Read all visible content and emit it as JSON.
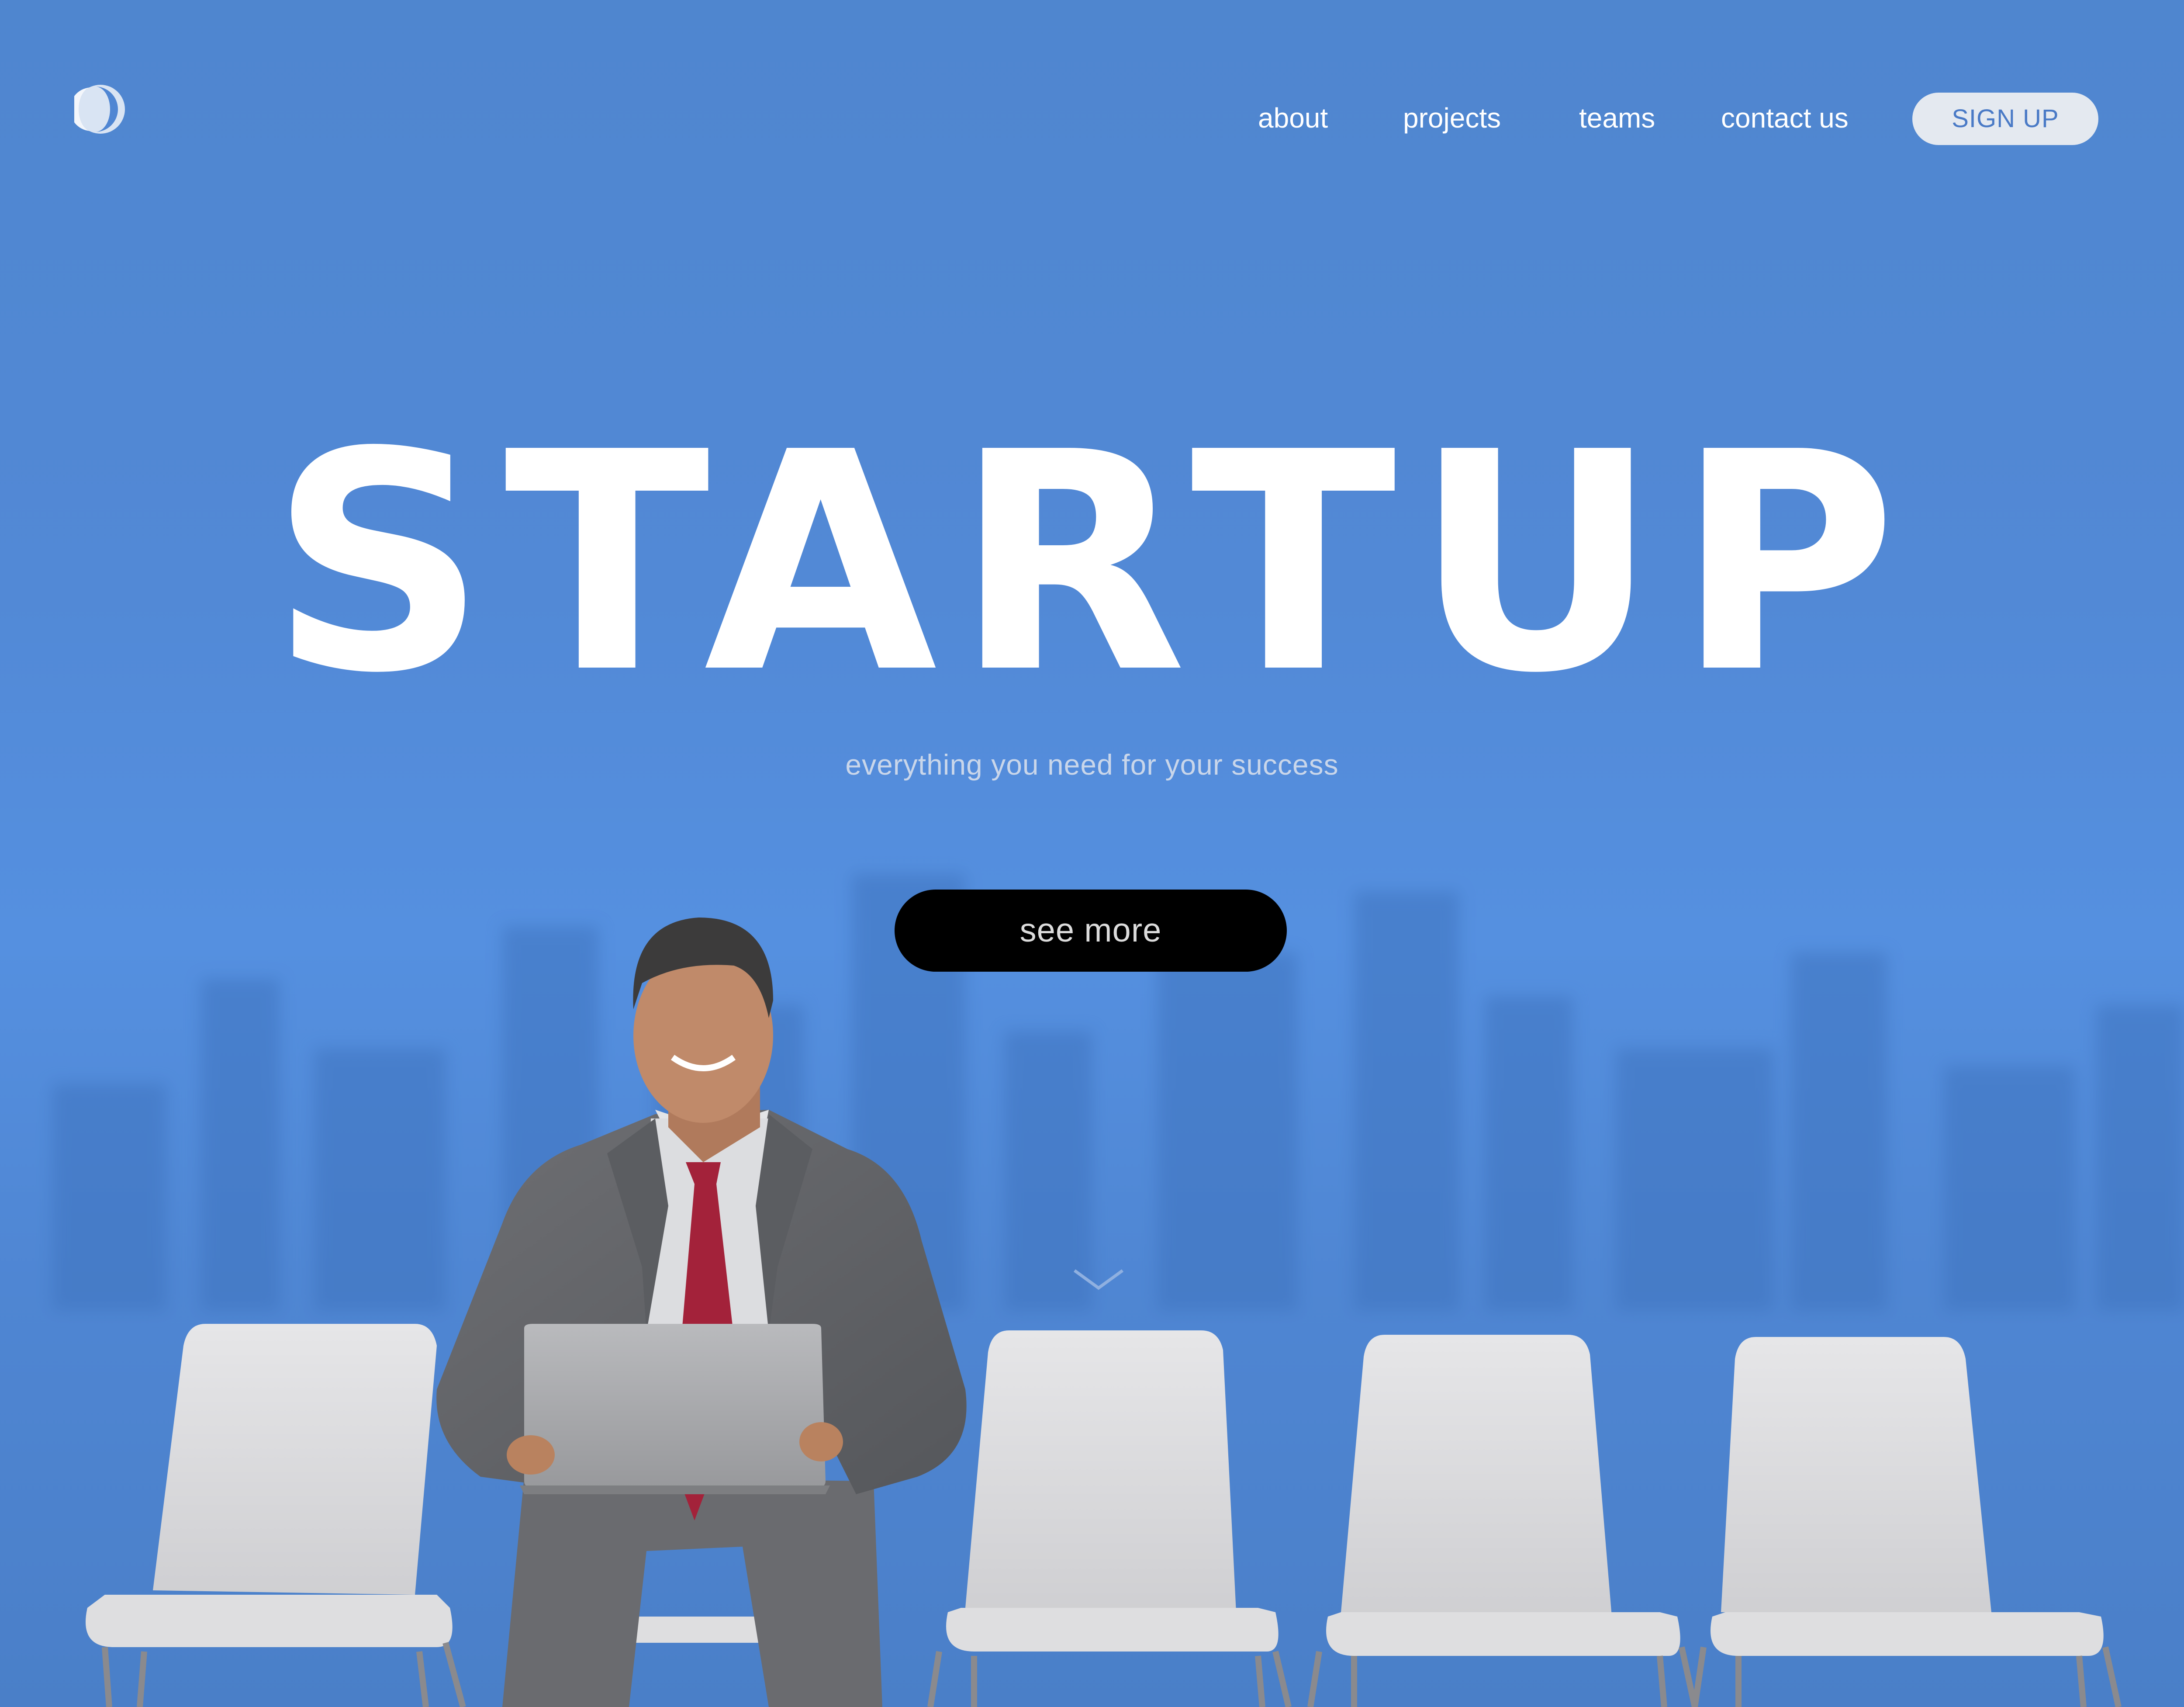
{
  "header": {
    "logo_icon": "crescent-logo-icon",
    "nav": [
      {
        "label": "about"
      },
      {
        "label": "projects"
      },
      {
        "label": "teams"
      },
      {
        "label": "contact us"
      }
    ],
    "signup_label": "SIGN UP"
  },
  "hero": {
    "title": "STARTUP",
    "subtitle": "everything you need for your success",
    "cta_label": "see more",
    "scroll_icon": "chevron-down-icon"
  },
  "colors": {
    "background": "#4f86d3",
    "cta_background": "#000000",
    "signup_background": "#e4e9f0",
    "signup_text": "#4a7ac6"
  }
}
